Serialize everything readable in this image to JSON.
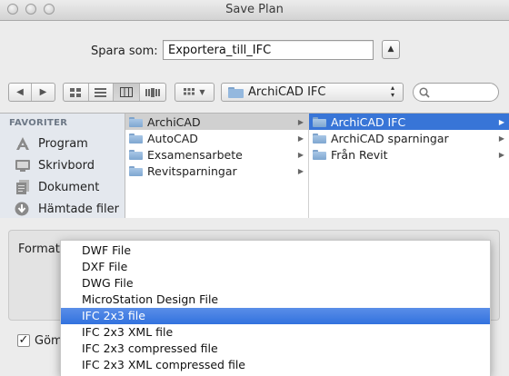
{
  "window": {
    "title": "Save Plan"
  },
  "saveas": {
    "label": "Spara som:",
    "value": "Exportera_till_IFC"
  },
  "toolbar": {
    "path": "ArchiCAD IFC",
    "view_mode": "columns"
  },
  "sidebar": {
    "heading": "FAVORITER",
    "items": [
      {
        "label": "Program",
        "icon": "applications-icon"
      },
      {
        "label": "Skrivbord",
        "icon": "desktop-icon"
      },
      {
        "label": "Dokument",
        "icon": "documents-icon"
      },
      {
        "label": "Hämtade filer",
        "icon": "downloads-icon"
      }
    ]
  },
  "columns": [
    {
      "items": [
        "ArchiCAD",
        "AutoCAD",
        "Exsamensarbete",
        "Revitsparningar"
      ],
      "selected": 0
    },
    {
      "items": [
        "ArchiCAD IFC",
        "ArchiCAD sparningar",
        "Från Revit"
      ],
      "selected": 0
    }
  ],
  "format": {
    "label": "Format",
    "options": [
      "DWF File",
      "DXF File",
      "DWG File",
      "MicroStation Design File",
      "IFC 2x3 file",
      "IFC 2x3 XML file",
      "IFC 2x3 compressed file",
      "IFC 2x3 XML compressed file"
    ],
    "selected": "IFC 2x3 file"
  },
  "hide_extension": {
    "label": "Göm",
    "checked": true
  },
  "colors": {
    "selection_blue": "#3875d7",
    "sidebar_bg": "#e4e8ee"
  }
}
